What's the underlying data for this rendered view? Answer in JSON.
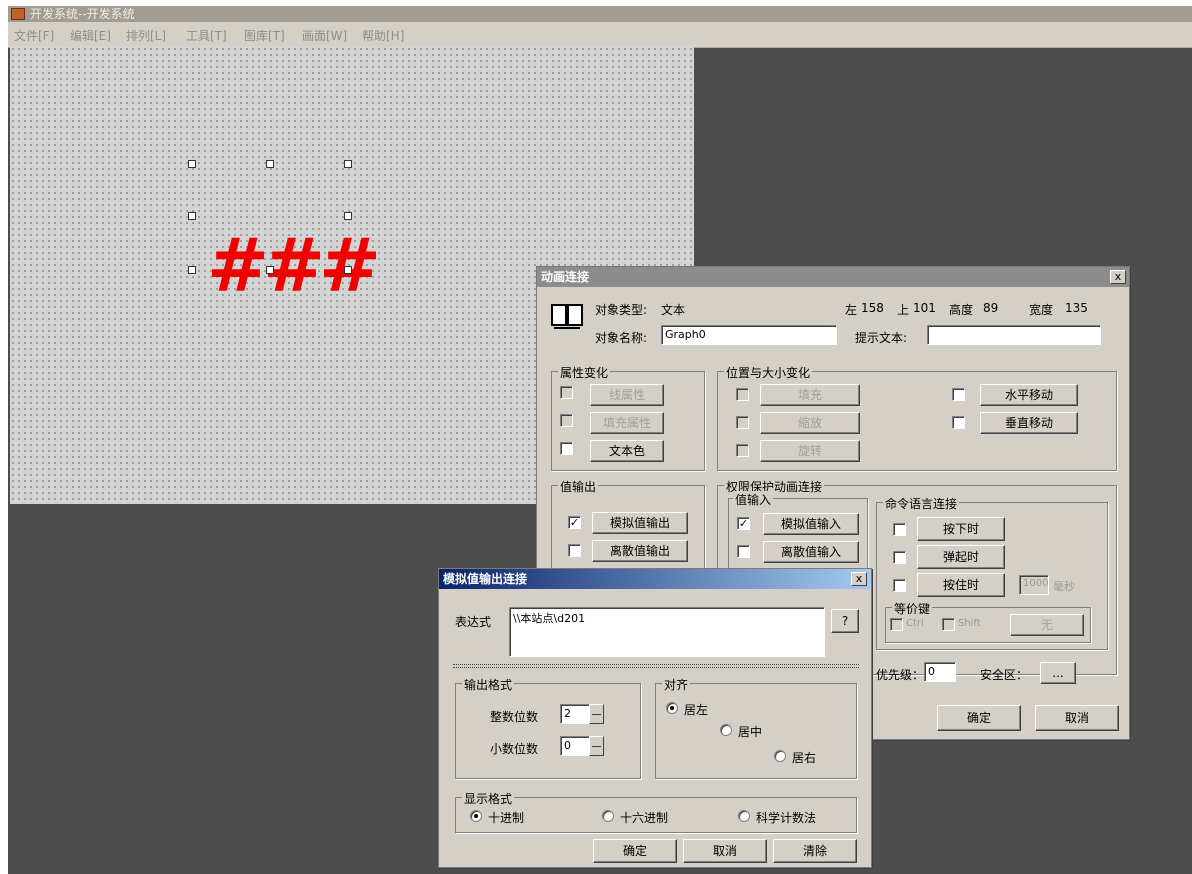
{
  "app": {
    "title": "开发系统--开发系统",
    "menu": [
      "文件[F]",
      "编辑[E]",
      "排列[L]",
      "工具[T]",
      "图库[T]",
      "画面[W]",
      "帮助[H]"
    ]
  },
  "canvas": {
    "object_text": "###"
  },
  "anim_dialog": {
    "title": "动画连接",
    "close": "x",
    "object_type_label": "对象类型:",
    "object_type_value": "文本",
    "left_label": "左",
    "left_value": "158",
    "top_label": "上",
    "top_value": "101",
    "height_label": "高度",
    "height_value": "89",
    "width_label": "宽度",
    "width_value": "135",
    "object_name_label": "对象名称:",
    "object_name_value": "Graph0",
    "hint_text_label": "提示文本:",
    "hint_text_value": "",
    "prop_group": {
      "title": "属性变化",
      "items": [
        {
          "label": "线属性",
          "checked": false,
          "enabled": false
        },
        {
          "label": "填充属性",
          "checked": false,
          "enabled": false
        },
        {
          "label": "文本色",
          "checked": false,
          "enabled": true
        }
      ]
    },
    "pos_group": {
      "title": "位置与大小变化",
      "items": [
        {
          "label": "填充",
          "enabled": false
        },
        {
          "label": "缩放",
          "enabled": false
        },
        {
          "label": "旋转",
          "enabled": false
        }
      ],
      "move_items": [
        {
          "label": "水平移动",
          "enabled": true
        },
        {
          "label": "垂直移动",
          "enabled": true
        }
      ]
    },
    "value_output": {
      "title": "值输出",
      "items": [
        {
          "label": "模拟值输出",
          "checked": true
        },
        {
          "label": "离散值输出",
          "checked": false
        }
      ]
    },
    "perm_group": {
      "title": "权限保护动画连接"
    },
    "value_input": {
      "title": "值输入",
      "items": [
        {
          "label": "模拟值输入",
          "checked": true
        },
        {
          "label": "离散值输入",
          "checked": false
        }
      ]
    },
    "command_group": {
      "title": "命令语言连接",
      "items": [
        {
          "label": "按下时"
        },
        {
          "label": "弹起时"
        },
        {
          "label": "按住时"
        }
      ],
      "interval_value": "1000",
      "interval_unit": "毫秒"
    },
    "hotkey": {
      "title": "等价键",
      "ctrl": "Ctrl",
      "shift": "Shift",
      "key_button": "无"
    },
    "priority_label": "优先级：",
    "priority_value": "0",
    "security_label": "安全区：",
    "security_button": "...",
    "ok": "确定",
    "cancel": "取消"
  },
  "output_dialog": {
    "title": "模拟值输出连接",
    "close": "x",
    "expression_label": "表达式",
    "expression_value": "\\\\本站点\\d201",
    "help_button": "?",
    "format_group": {
      "title": "输出格式",
      "int_label": "整数位数",
      "int_value": "2",
      "dec_label": "小数位数",
      "dec_value": "0"
    },
    "align_group": {
      "title": "对齐",
      "options": [
        "居左",
        "居中",
        "居右"
      ],
      "selected": 0
    },
    "display_group": {
      "title": "显示格式",
      "options": [
        "十进制",
        "十六进制",
        "科学计数法"
      ],
      "selected": 0
    },
    "ok": "确定",
    "cancel": "取消",
    "clear": "清除"
  },
  "colors": {
    "desktop": "#4d4d4d",
    "dialog_face": "#d4d0c8",
    "active_title_start": "#0a246a",
    "active_title_end": "#a6caf0",
    "inactive_title": "#8c8c8c",
    "graphic_red": "#f20000"
  }
}
